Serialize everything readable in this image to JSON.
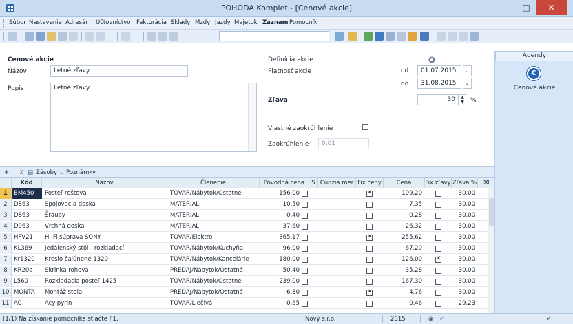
{
  "window": {
    "title": "POHODA Komplet - [Cenové akcie]",
    "minimize": "–",
    "maximize": "□",
    "close": "✕"
  },
  "menu": [
    "Súbor",
    "Nastavenie",
    "Adresár",
    "Účtovníctvo",
    "Fakturácia",
    "Sklady",
    "Mzdy",
    "Jazdy",
    "Majetok",
    "Záznam",
    "Pomocník"
  ],
  "form": {
    "section_title": "Cenové akcie",
    "nazov_label": "Názov",
    "nazov_value": "Letné zľavy",
    "popis_label": "Popis",
    "popis_value": "Letné zľavy",
    "definicia_title": "Definícia akcie",
    "platnost_label": "Platnosť akcie",
    "od_label": "od",
    "od_value": "01.07.2015",
    "do_label": "do",
    "do_value": "31.08.2015",
    "zlava_label": "Zľava",
    "zlava_value": "30",
    "zlava_unit": "%",
    "vlastne_label": "Vlastné zaokrúhlenie",
    "zaokruhlenie_label": "Zaokrúhlenie",
    "zaokruhlenie_value": "0,01"
  },
  "agenda": {
    "header": "Agendy",
    "item_label": "Cenové akcie"
  },
  "tabs": {
    "zasoby": "Zásoby",
    "poznamky": "Poznámky"
  },
  "grid": {
    "headers": {
      "kod": "Kód",
      "nazov": "Názov",
      "clenenie": "Členenie",
      "povodna": "Pôvodná cena",
      "s": "S",
      "cudzia": "Cudzia mer",
      "fixceny": "Fix ceny",
      "cena": "Cena",
      "fixzlavy": "Fix zľavy",
      "zlava": "Zľava %"
    },
    "rows": [
      {
        "num": "1",
        "kod": "BM450",
        "nazov": "Posteľ roštová",
        "clenenie": "TOVAR/Nábytok/Ostatné",
        "povodna": "156,00",
        "fixceny": true,
        "cena": "109,20",
        "fixzlavy": false,
        "zlava": "30,00"
      },
      {
        "num": "2",
        "kod": "D863",
        "nazov": "Spojovacia doska",
        "clenenie": "MATERIÁL",
        "povodna": "10,50",
        "fixceny": false,
        "cena": "7,35",
        "fixzlavy": false,
        "zlava": "30,00"
      },
      {
        "num": "3",
        "kod": "D863",
        "nazov": "Šrauby",
        "clenenie": "MATERIÁL",
        "povodna": "0,40",
        "fixceny": false,
        "cena": "0,28",
        "fixzlavy": false,
        "zlava": "30,00"
      },
      {
        "num": "4",
        "kod": "D963",
        "nazov": "Vrchná doska",
        "clenenie": "MATERIÁL",
        "povodna": "37,60",
        "fixceny": false,
        "cena": "26,32",
        "fixzlavy": false,
        "zlava": "30,00"
      },
      {
        "num": "5",
        "kod": "HFV21",
        "nazov": "Hi-Fi súprava SONY",
        "clenenie": "TOVAR/Elektro",
        "povodna": "365,17",
        "fixceny": true,
        "cena": "255,62",
        "fixzlavy": false,
        "zlava": "30,00"
      },
      {
        "num": "6",
        "kod": "KL369",
        "nazov": "Jedálenský stôl - rozkladací",
        "clenenie": "TOVAR/Nábytok/Kuchyňa",
        "povodna": "96,00",
        "fixceny": false,
        "cena": "67,20",
        "fixzlavy": false,
        "zlava": "30,00"
      },
      {
        "num": "7",
        "kod": "Kr1320",
        "nazov": "Kreslo čalúnené 1320",
        "clenenie": "TOVAR/Nábytok/Kancelárie",
        "povodna": "180,00",
        "fixceny": false,
        "cena": "126,00",
        "fixzlavy": true,
        "zlava": "30,00"
      },
      {
        "num": "8",
        "kod": "KR20a",
        "nazov": "Skrinka rohová",
        "clenenie": "PREDAJ/Nábytok/Ostatné",
        "povodna": "50,40",
        "fixceny": false,
        "cena": "35,28",
        "fixzlavy": false,
        "zlava": "30,00"
      },
      {
        "num": "9",
        "kod": "L560",
        "nazov": "Rozkladacia posteľ 1425",
        "clenenie": "TOVAR/Nábytok/Ostatné",
        "povodna": "239,00",
        "fixceny": false,
        "cena": "167,30",
        "fixzlavy": false,
        "zlava": "30,00"
      },
      {
        "num": "10",
        "kod": "MONTA",
        "nazov": "Montáž stola",
        "clenenie": "PREDAJ/Nábytok/Ostatné",
        "povodna": "6,80",
        "fixceny": true,
        "cena": "4,76",
        "fixzlavy": false,
        "zlava": "30,00"
      },
      {
        "num": "11",
        "kod": "AC",
        "nazov": "Acylpyrin",
        "clenenie": "TOVAR/Liečivá",
        "povodna": "0,65",
        "fixceny": false,
        "cena": "0,46",
        "fixzlavy": false,
        "zlava": "29,23"
      }
    ]
  },
  "status": {
    "help": "(1/1) Na získanie pomocníka stlačte F1.",
    "company": "Nový s.r.o.",
    "year": "2015"
  },
  "colors": {
    "titlebar": "#c8dcf2",
    "close_button": "#c9463d",
    "active_row_marker": "#f3c44c",
    "active_cell": "#1c2e4a",
    "agenda_icon": "#1f64b5"
  },
  "icons": {
    "app": "pohoda-app-icon",
    "agenda": "price-action-icon",
    "help_circle": "help-icon",
    "status_globe": "globe-icon",
    "status_check": "check-icon"
  }
}
